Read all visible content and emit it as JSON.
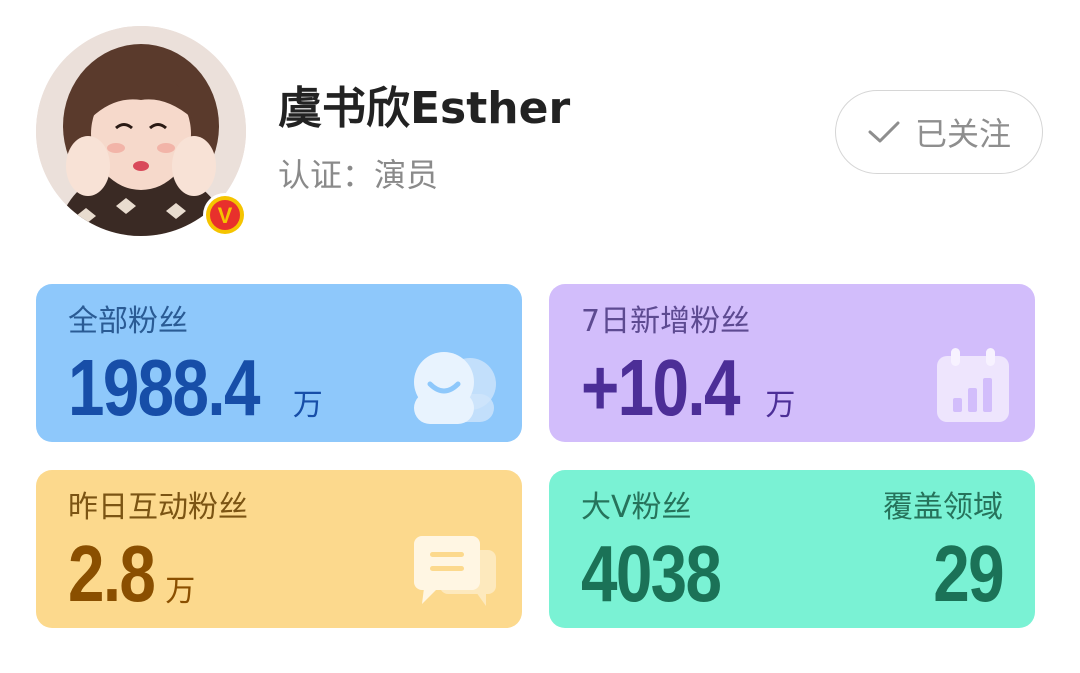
{
  "profile": {
    "name": "虞书欣Esther",
    "cert_label": "认证：",
    "cert_value": "演员",
    "badge": "V",
    "follow_label": "已关注",
    "follow_icon": "checkmark-icon"
  },
  "stats": {
    "total_fans": {
      "label": "全部粉丝",
      "value": "1988.4",
      "unit": "万",
      "icon": "fans-icon",
      "color": "#8ec8fb"
    },
    "new_fans_7d": {
      "label": "7日新增粉丝",
      "value": "+10.4",
      "unit": "万",
      "icon": "calendar-chart-icon",
      "color": "#d2bdfb"
    },
    "interactive_fans": {
      "label": "昨日互动粉丝",
      "value": "2.8",
      "unit": "万",
      "icon": "chat-icon",
      "color": "#fcd98d"
    },
    "big_v": {
      "label": "大V粉丝",
      "value": "4038",
      "coverage_label": "覆盖领域",
      "coverage_value": "29",
      "color": "#7af2d4"
    }
  }
}
